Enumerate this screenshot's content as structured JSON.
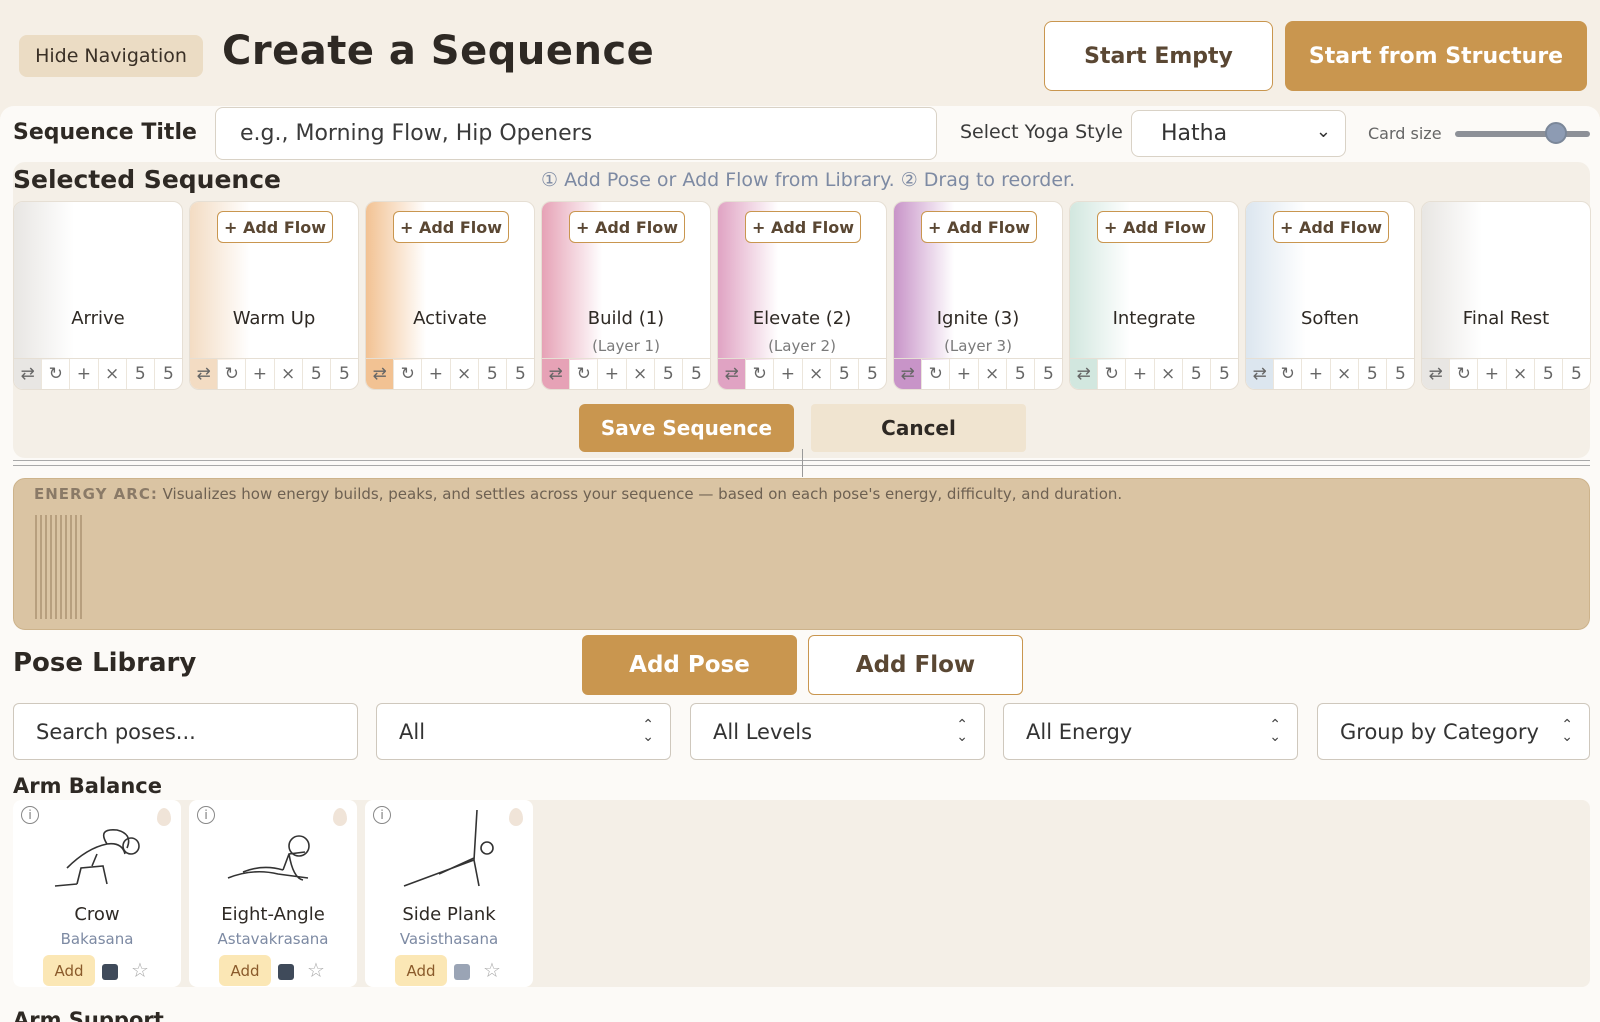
{
  "header": {
    "hide_nav_label": "Hide Navigation",
    "title": "Create a Sequence",
    "start_empty_label": "Start Empty",
    "start_structure_label": "Start from Structure"
  },
  "form": {
    "sequence_title_label": "Sequence Title",
    "sequence_title_placeholder": "e.g., Morning Flow, Hip Openers",
    "sequence_title_value": "",
    "yoga_style_label": "Select Yoga Style",
    "yoga_style_value": "Hatha",
    "card_size_label": "Card size",
    "card_size_level": 0.75
  },
  "selected_sequence": {
    "title": "Selected Sequence",
    "hint": "① Add Pose or Add Flow from Library. ② Drag to reorder.",
    "add_flow_label": "+ Add Flow",
    "stages": [
      {
        "name": "Arrive",
        "layer": "",
        "color": "#e8e6e3",
        "has_add_flow": false
      },
      {
        "name": "Warm Up",
        "layer": "",
        "color": "#f3dcc3",
        "has_add_flow": true
      },
      {
        "name": "Activate",
        "layer": "",
        "color": "#f2c293",
        "has_add_flow": true
      },
      {
        "name": "Build (1)",
        "layer": "(Layer 1)",
        "color": "#e6a2b6",
        "has_add_flow": true
      },
      {
        "name": "Elevate (2)",
        "layer": "(Layer 2)",
        "color": "#e0a3c3",
        "has_add_flow": true
      },
      {
        "name": "Ignite (3)",
        "layer": "(Layer 3)",
        "color": "#c894c8",
        "has_add_flow": true
      },
      {
        "name": "Integrate",
        "layer": "",
        "color": "#d2e7df",
        "has_add_flow": true
      },
      {
        "name": "Soften",
        "layer": "",
        "color": "#dce6ef",
        "has_add_flow": true
      },
      {
        "name": "Final Rest",
        "layer": "",
        "color": "#e8e6e3",
        "has_add_flow": false
      }
    ],
    "controls": [
      "⇄",
      "↻",
      "+",
      "×",
      "5",
      "5"
    ],
    "save_label": "Save Sequence",
    "cancel_label": "Cancel"
  },
  "energy_arc": {
    "label": "ENERGY ARC:",
    "description": "Visualizes how energy builds, peaks, and settles across your sequence — based on each pose's energy, difficulty, and duration."
  },
  "pose_library": {
    "title": "Pose Library",
    "add_pose_label": "Add Pose",
    "add_flow_label": "Add Flow",
    "search_placeholder": "Search poses...",
    "filter_category": "All",
    "filter_levels": "All Levels",
    "filter_energy": "All Energy",
    "group_by": "Group by Category",
    "categories": [
      {
        "name": "Arm Balance",
        "poses": [
          {
            "name": "Crow",
            "sanskrit": "Bakasana",
            "add_label": "Add",
            "level_color": "#3f4a5a"
          },
          {
            "name": "Eight-Angle",
            "sanskrit": "Astavakrasana",
            "add_label": "Add",
            "level_color": "#3f4a5a"
          },
          {
            "name": "Side Plank",
            "sanskrit": "Vasisthasana",
            "add_label": "Add",
            "level_color": "#9aa4b5"
          }
        ]
      }
    ],
    "next_category": "Arm Support"
  },
  "colors": {
    "accent": "#c9964f",
    "background": "#f5efe6",
    "energy_panel": "#dac4a3"
  }
}
